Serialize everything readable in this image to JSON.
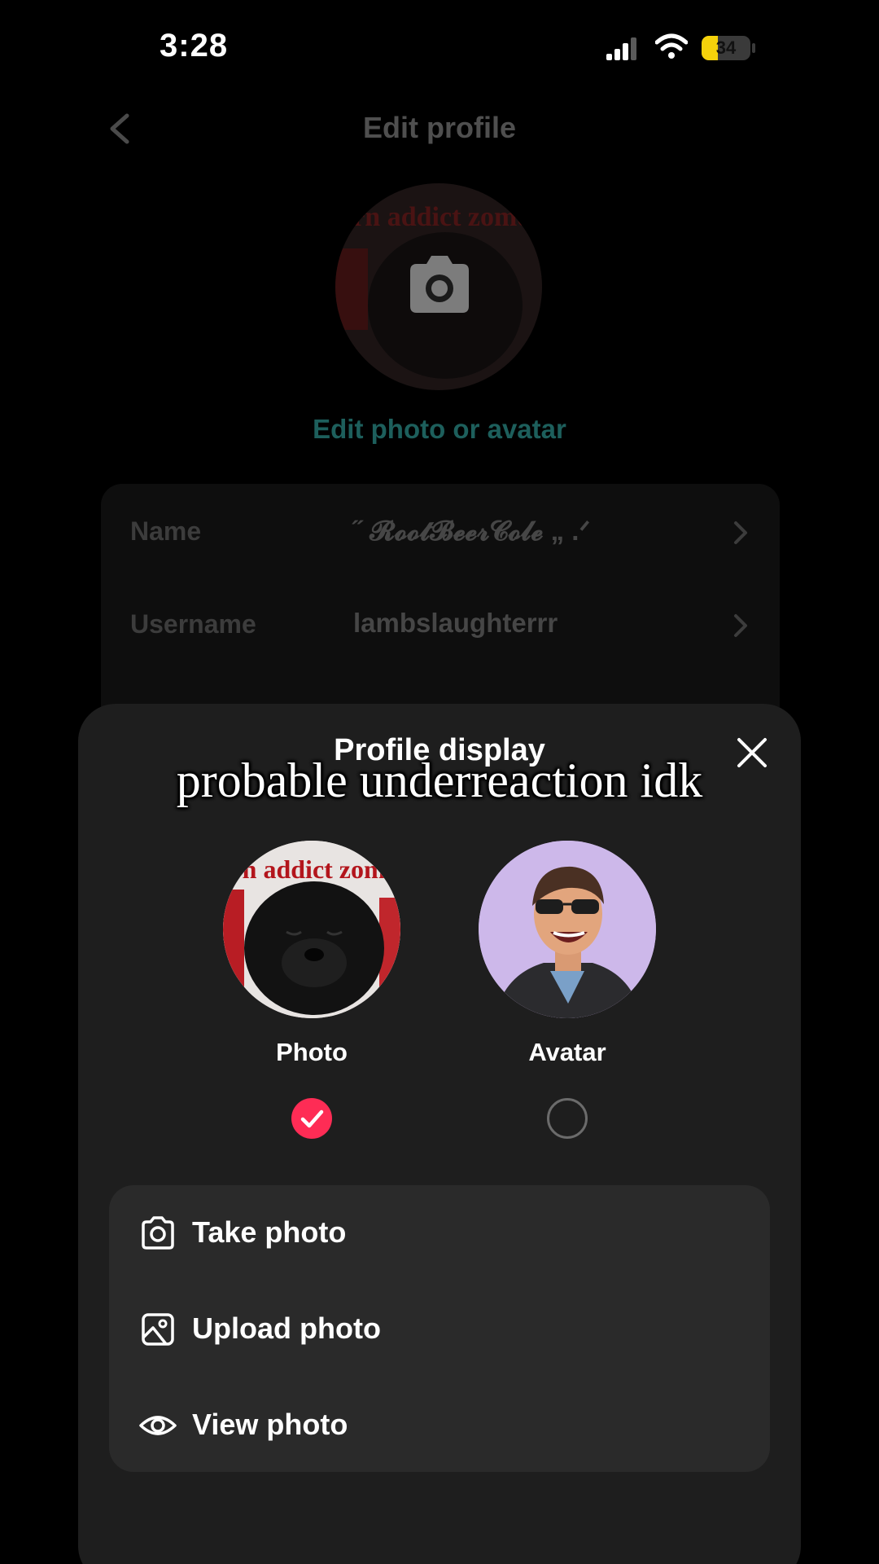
{
  "status_bar": {
    "time": "3:28",
    "battery": "34",
    "battery_level": 0.34
  },
  "background": {
    "title": "Edit profile",
    "edit_photo_link": "Edit photo or avatar",
    "fields": [
      {
        "label": "Name",
        "value": "˝ 𝓡𝓸𝓸𝓽𝓑𝓮𝓮𝓻𝓒𝓸𝓵𝓮 „ .ᐟ"
      },
      {
        "label": "Username",
        "value": "lambslaughterrr"
      }
    ],
    "photo_text": "orn addict zomoi"
  },
  "sheet": {
    "title": "Profile display",
    "caption": "probable underreaction idk",
    "choices": [
      {
        "label": "Photo",
        "selected": true,
        "photo_text": "orn addict zomoi"
      },
      {
        "label": "Avatar",
        "selected": false
      }
    ],
    "options": [
      {
        "label": "Take photo",
        "icon": "camera-icon"
      },
      {
        "label": "Upload photo",
        "icon": "image-icon"
      },
      {
        "label": "View photo",
        "icon": "eye-icon"
      }
    ]
  },
  "colors": {
    "accent": "#fe2c55",
    "link_dim": "#1d5f5c",
    "sheet_bg": "#1e1e1e",
    "card_bg": "#2a2a2a"
  }
}
